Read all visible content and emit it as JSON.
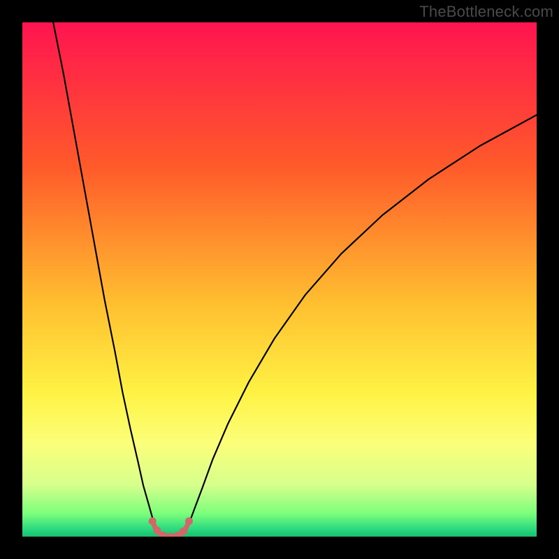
{
  "watermark": "TheBottleneck.com",
  "chart_data": {
    "type": "line",
    "title": "",
    "xlabel": "",
    "ylabel": "",
    "xlim": [
      0,
      100
    ],
    "ylim": [
      0,
      100
    ],
    "background_gradient": {
      "stops": [
        {
          "offset": 0.0,
          "color": "#ff1450"
        },
        {
          "offset": 0.28,
          "color": "#ff5a2a"
        },
        {
          "offset": 0.55,
          "color": "#ffc030"
        },
        {
          "offset": 0.72,
          "color": "#fff244"
        },
        {
          "offset": 0.82,
          "color": "#fbff7a"
        },
        {
          "offset": 0.9,
          "color": "#d6ff8c"
        },
        {
          "offset": 0.955,
          "color": "#7cff7c"
        },
        {
          "offset": 0.985,
          "color": "#2bd97f"
        },
        {
          "offset": 1.0,
          "color": "#18c06e"
        }
      ]
    },
    "series": [
      {
        "name": "left-branch",
        "stroke": "#000000",
        "stroke_width": 2.2,
        "x": [
          6.0,
          8.0,
          10.0,
          12.0,
          14.0,
          16.0,
          18.0,
          19.5,
          21.0,
          22.5,
          23.5,
          24.5,
          25.2,
          25.8,
          26.3,
          26.8
        ],
        "y": [
          100.0,
          90.0,
          79.0,
          68.0,
          57.0,
          46.0,
          36.0,
          28.0,
          21.0,
          14.5,
          10.0,
          6.5,
          4.0,
          2.2,
          1.0,
          0.4
        ]
      },
      {
        "name": "right-branch",
        "stroke": "#000000",
        "stroke_width": 2.2,
        "x": [
          31.2,
          31.8,
          32.5,
          33.5,
          35.0,
          37.0,
          40.0,
          44.0,
          49.0,
          55.0,
          62.0,
          70.0,
          79.0,
          89.0,
          100.0
        ],
        "y": [
          0.4,
          1.2,
          2.8,
          5.5,
          9.5,
          15.0,
          22.0,
          30.0,
          38.5,
          47.0,
          55.0,
          62.5,
          69.5,
          76.0,
          82.0
        ]
      },
      {
        "name": "trough",
        "stroke": "#cf6868",
        "stroke_width": 7,
        "x": [
          25.3,
          25.8,
          26.4,
          27.0,
          27.8,
          28.8,
          29.8,
          30.6,
          31.3,
          31.9,
          32.4
        ],
        "y": [
          3.0,
          1.8,
          0.9,
          0.35,
          0.1,
          0.0,
          0.1,
          0.35,
          0.9,
          1.8,
          3.0
        ]
      }
    ],
    "trough_dots": {
      "color": "#cf6868",
      "radius": 5.5,
      "points": [
        {
          "x": 25.3,
          "y": 3.0
        },
        {
          "x": 26.2,
          "y": 1.2
        },
        {
          "x": 27.4,
          "y": 0.25
        },
        {
          "x": 28.8,
          "y": 0.0
        },
        {
          "x": 30.2,
          "y": 0.25
        },
        {
          "x": 31.3,
          "y": 1.0
        },
        {
          "x": 32.4,
          "y": 3.0
        }
      ]
    }
  }
}
